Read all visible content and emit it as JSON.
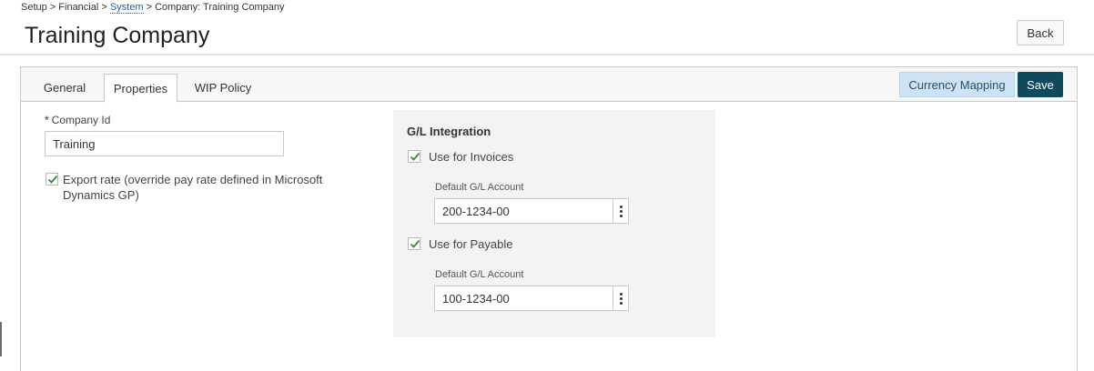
{
  "breadcrumb": {
    "part1": "Setup > Financial > ",
    "link": "System",
    "part2": " > Company: Training Company"
  },
  "page": {
    "title": "Training Company"
  },
  "header": {
    "back_label": "Back"
  },
  "tabs": [
    {
      "label": "General"
    },
    {
      "label": "Properties"
    },
    {
      "label": "WIP Policy"
    }
  ],
  "toolbar": {
    "currency_mapping_label": "Currency Mapping",
    "save_label": "Save"
  },
  "form": {
    "company_id_required": "*",
    "company_id_label": "Company Id",
    "company_id_value": "Training",
    "export_rate_label": "Export rate (override pay rate defined in Microsoft Dynamics GP)",
    "export_rate_checked": true
  },
  "gl": {
    "title": "G/L Integration",
    "invoices_label": "Use for Invoices",
    "invoices_checked": true,
    "invoices_account_label": "Default G/L Account",
    "invoices_account_value": "200-1234-00",
    "payable_label": "Use for Payable",
    "payable_checked": true,
    "payable_account_label": "Default G/L Account",
    "payable_account_value": "100-1234-00"
  },
  "colors": {
    "save_bg": "#0f4a5c",
    "currency_bg": "#cfe2f3",
    "check_green": "#3a8a3a",
    "link_blue": "#1f5f9b"
  }
}
